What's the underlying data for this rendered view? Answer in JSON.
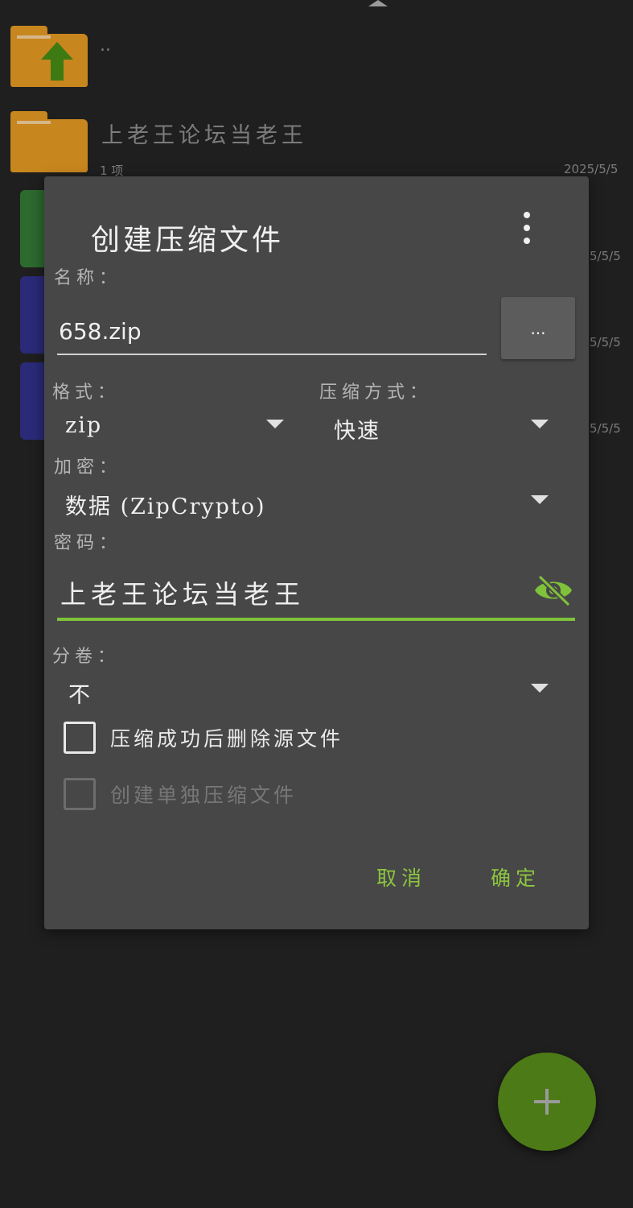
{
  "file_list": {
    "parent_label": "..",
    "folder_name": "上老王论坛当老王",
    "folder_meta": "1 项",
    "folder_date": "2025/5/5",
    "row_dates": [
      "5/5/5",
      "5/5/5",
      "5/5/5"
    ]
  },
  "dialog": {
    "title": "创建压缩文件",
    "name_label": "名称：",
    "name_value": "658.zip",
    "browse_label": "...",
    "format_label": "格式：",
    "format_value": "zip",
    "method_label": "压缩方式：",
    "method_value": "快速",
    "encryption_label": "加密：",
    "encryption_value": "数据 (ZipCrypto)",
    "password_label": "密码：",
    "password_value": "上老王论坛当老王",
    "split_label": "分卷：",
    "split_value": "不",
    "delete_source_label": "压缩成功后删除源文件",
    "delete_source_checked": false,
    "separate_archive_label": "创建单独压缩文件",
    "separate_archive_enabled": false,
    "cancel_label": "取消",
    "ok_label": "确定"
  },
  "colors": {
    "accent": "#8cc63f",
    "dialog_bg": "#474747",
    "fab_bg": "#4c7a17",
    "folder": "#c8861e"
  },
  "icons": {
    "more": "more-vert-icon",
    "eye": "eye-off-icon",
    "fab": "plus-icon",
    "parent": "folder-up-icon"
  }
}
